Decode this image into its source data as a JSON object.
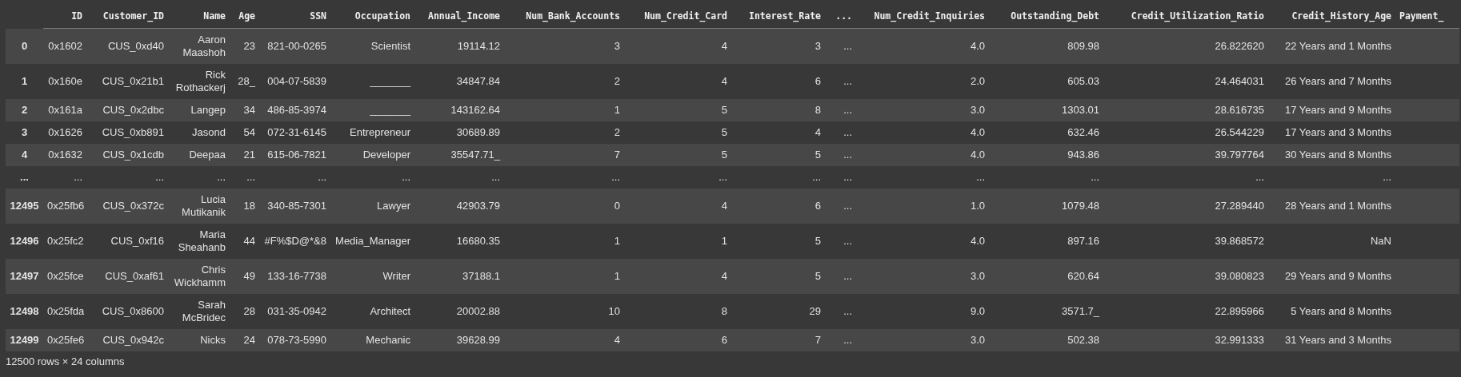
{
  "table": {
    "columns": [
      "ID",
      "Customer_ID",
      "Name",
      "Age",
      "SSN",
      "Occupation",
      "Annual_Income",
      "Num_Bank_Accounts",
      "Num_Credit_Card",
      "Interest_Rate",
      "...",
      "Num_Credit_Inquiries",
      "Outstanding_Debt",
      "Credit_Utilization_Ratio",
      "Credit_History_Age",
      "Payment_"
    ],
    "rows": [
      {
        "index": "0",
        "cells": [
          "0x1602",
          "CUS_0xd40",
          "Aaron Maashoh",
          "23",
          "821-00-0265",
          "Scientist",
          "19114.12",
          "3",
          "4",
          "3",
          "...",
          "4.0",
          "809.98",
          "26.822620",
          "22 Years and 1 Months"
        ]
      },
      {
        "index": "1",
        "cells": [
          "0x160e",
          "CUS_0x21b1",
          "Rick Rothackerj",
          "28_",
          "004-07-5839",
          "_______",
          "34847.84",
          "2",
          "4",
          "6",
          "...",
          "2.0",
          "605.03",
          "24.464031",
          "26 Years and 7 Months"
        ]
      },
      {
        "index": "2",
        "cells": [
          "0x161a",
          "CUS_0x2dbc",
          "Langep",
          "34",
          "486-85-3974",
          "_______",
          "143162.64",
          "1",
          "5",
          "8",
          "...",
          "3.0",
          "1303.01",
          "28.616735",
          "17 Years and 9 Months"
        ]
      },
      {
        "index": "3",
        "cells": [
          "0x1626",
          "CUS_0xb891",
          "Jasond",
          "54",
          "072-31-6145",
          "Entrepreneur",
          "30689.89",
          "2",
          "5",
          "4",
          "...",
          "4.0",
          "632.46",
          "26.544229",
          "17 Years and 3 Months"
        ]
      },
      {
        "index": "4",
        "cells": [
          "0x1632",
          "CUS_0x1cdb",
          "Deepaa",
          "21",
          "615-06-7821",
          "Developer",
          "35547.71_",
          "7",
          "5",
          "5",
          "...",
          "4.0",
          "943.86",
          "39.797764",
          "30 Years and 8 Months"
        ]
      },
      {
        "index": "...",
        "cells": [
          "...",
          "...",
          "...",
          "...",
          "...",
          "...",
          "...",
          "...",
          "...",
          "...",
          "...",
          "...",
          "...",
          "...",
          "..."
        ]
      },
      {
        "index": "12495",
        "cells": [
          "0x25fb6",
          "CUS_0x372c",
          "Lucia Mutikanik",
          "18",
          "340-85-7301",
          "Lawyer",
          "42903.79",
          "0",
          "4",
          "6",
          "...",
          "1.0",
          "1079.48",
          "27.289440",
          "28 Years and 1 Months"
        ]
      },
      {
        "index": "12496",
        "cells": [
          "0x25fc2",
          "CUS_0xf16",
          "Maria Sheahanb",
          "44",
          "#F%$D@*&8",
          "Media_Manager",
          "16680.35",
          "1",
          "1",
          "5",
          "...",
          "4.0",
          "897.16",
          "39.868572",
          "NaN"
        ]
      },
      {
        "index": "12497",
        "cells": [
          "0x25fce",
          "CUS_0xaf61",
          "Chris Wickhamm",
          "49",
          "133-16-7738",
          "Writer",
          "37188.1",
          "1",
          "4",
          "5",
          "...",
          "3.0",
          "620.64",
          "39.080823",
          "29 Years and 9 Months"
        ]
      },
      {
        "index": "12498",
        "cells": [
          "0x25fda",
          "CUS_0x8600",
          "Sarah McBridec",
          "28",
          "031-35-0942",
          "Architect",
          "20002.88",
          "10",
          "8",
          "29",
          "...",
          "9.0",
          "3571.7_",
          "22.895966",
          "5 Years and 8 Months"
        ]
      },
      {
        "index": "12499",
        "cells": [
          "0x25fe6",
          "CUS_0x942c",
          "Nicks",
          "24",
          "078-73-5990",
          "Mechanic",
          "39628.99",
          "4",
          "6",
          "7",
          "...",
          "3.0",
          "502.38",
          "32.991333",
          "31 Years and 3 Months"
        ]
      }
    ]
  },
  "footer": "12500 rows × 24 columns"
}
